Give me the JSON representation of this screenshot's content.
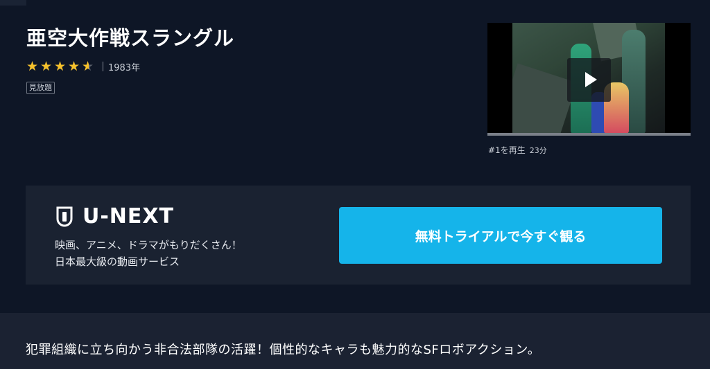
{
  "title": "亜空大作戦スラングル",
  "rating": {
    "value": 4.5,
    "max": 5,
    "star_color": "#f6c12b"
  },
  "year": "1983年",
  "badge": "見放題",
  "player": {
    "icon": "play-icon"
  },
  "episode": {
    "label": "#1を再生",
    "duration": "23分"
  },
  "promo": {
    "logo_text": "U-NEXT",
    "tagline_line1": "映画、アニメ、ドラマがもりだくさん！",
    "tagline_line2": "日本最大級の動画サービス",
    "cta_label": "無料トライアルで今すぐ観る",
    "cta_color": "#15b4ea"
  },
  "description": "犯罪組織に立ち向かう非合法部隊の活躍！個性的なキャラも魅力的なSFロボアクション。"
}
